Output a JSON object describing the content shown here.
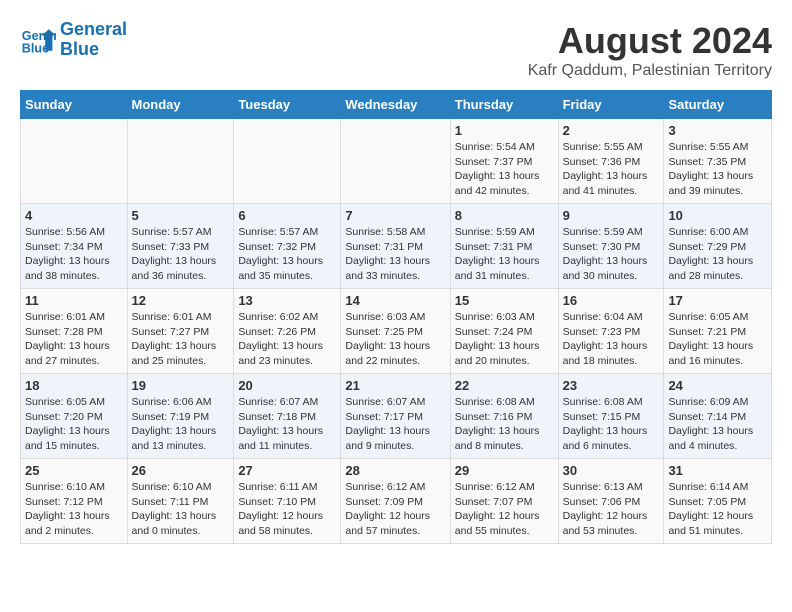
{
  "header": {
    "logo_line1": "General",
    "logo_line2": "Blue",
    "title": "August 2024",
    "subtitle": "Kafr Qaddum, Palestinian Territory"
  },
  "calendar": {
    "days_of_week": [
      "Sunday",
      "Monday",
      "Tuesday",
      "Wednesday",
      "Thursday",
      "Friday",
      "Saturday"
    ],
    "weeks": [
      [
        {
          "day": "",
          "info": ""
        },
        {
          "day": "",
          "info": ""
        },
        {
          "day": "",
          "info": ""
        },
        {
          "day": "",
          "info": ""
        },
        {
          "day": "1",
          "info": "Sunrise: 5:54 AM\nSunset: 7:37 PM\nDaylight: 13 hours\nand 42 minutes."
        },
        {
          "day": "2",
          "info": "Sunrise: 5:55 AM\nSunset: 7:36 PM\nDaylight: 13 hours\nand 41 minutes."
        },
        {
          "day": "3",
          "info": "Sunrise: 5:55 AM\nSunset: 7:35 PM\nDaylight: 13 hours\nand 39 minutes."
        }
      ],
      [
        {
          "day": "4",
          "info": "Sunrise: 5:56 AM\nSunset: 7:34 PM\nDaylight: 13 hours\nand 38 minutes."
        },
        {
          "day": "5",
          "info": "Sunrise: 5:57 AM\nSunset: 7:33 PM\nDaylight: 13 hours\nand 36 minutes."
        },
        {
          "day": "6",
          "info": "Sunrise: 5:57 AM\nSunset: 7:32 PM\nDaylight: 13 hours\nand 35 minutes."
        },
        {
          "day": "7",
          "info": "Sunrise: 5:58 AM\nSunset: 7:31 PM\nDaylight: 13 hours\nand 33 minutes."
        },
        {
          "day": "8",
          "info": "Sunrise: 5:59 AM\nSunset: 7:31 PM\nDaylight: 13 hours\nand 31 minutes."
        },
        {
          "day": "9",
          "info": "Sunrise: 5:59 AM\nSunset: 7:30 PM\nDaylight: 13 hours\nand 30 minutes."
        },
        {
          "day": "10",
          "info": "Sunrise: 6:00 AM\nSunset: 7:29 PM\nDaylight: 13 hours\nand 28 minutes."
        }
      ],
      [
        {
          "day": "11",
          "info": "Sunrise: 6:01 AM\nSunset: 7:28 PM\nDaylight: 13 hours\nand 27 minutes."
        },
        {
          "day": "12",
          "info": "Sunrise: 6:01 AM\nSunset: 7:27 PM\nDaylight: 13 hours\nand 25 minutes."
        },
        {
          "day": "13",
          "info": "Sunrise: 6:02 AM\nSunset: 7:26 PM\nDaylight: 13 hours\nand 23 minutes."
        },
        {
          "day": "14",
          "info": "Sunrise: 6:03 AM\nSunset: 7:25 PM\nDaylight: 13 hours\nand 22 minutes."
        },
        {
          "day": "15",
          "info": "Sunrise: 6:03 AM\nSunset: 7:24 PM\nDaylight: 13 hours\nand 20 minutes."
        },
        {
          "day": "16",
          "info": "Sunrise: 6:04 AM\nSunset: 7:23 PM\nDaylight: 13 hours\nand 18 minutes."
        },
        {
          "day": "17",
          "info": "Sunrise: 6:05 AM\nSunset: 7:21 PM\nDaylight: 13 hours\nand 16 minutes."
        }
      ],
      [
        {
          "day": "18",
          "info": "Sunrise: 6:05 AM\nSunset: 7:20 PM\nDaylight: 13 hours\nand 15 minutes."
        },
        {
          "day": "19",
          "info": "Sunrise: 6:06 AM\nSunset: 7:19 PM\nDaylight: 13 hours\nand 13 minutes."
        },
        {
          "day": "20",
          "info": "Sunrise: 6:07 AM\nSunset: 7:18 PM\nDaylight: 13 hours\nand 11 minutes."
        },
        {
          "day": "21",
          "info": "Sunrise: 6:07 AM\nSunset: 7:17 PM\nDaylight: 13 hours\nand 9 minutes."
        },
        {
          "day": "22",
          "info": "Sunrise: 6:08 AM\nSunset: 7:16 PM\nDaylight: 13 hours\nand 8 minutes."
        },
        {
          "day": "23",
          "info": "Sunrise: 6:08 AM\nSunset: 7:15 PM\nDaylight: 13 hours\nand 6 minutes."
        },
        {
          "day": "24",
          "info": "Sunrise: 6:09 AM\nSunset: 7:14 PM\nDaylight: 13 hours\nand 4 minutes."
        }
      ],
      [
        {
          "day": "25",
          "info": "Sunrise: 6:10 AM\nSunset: 7:12 PM\nDaylight: 13 hours\nand 2 minutes."
        },
        {
          "day": "26",
          "info": "Sunrise: 6:10 AM\nSunset: 7:11 PM\nDaylight: 13 hours\nand 0 minutes."
        },
        {
          "day": "27",
          "info": "Sunrise: 6:11 AM\nSunset: 7:10 PM\nDaylight: 12 hours\nand 58 minutes."
        },
        {
          "day": "28",
          "info": "Sunrise: 6:12 AM\nSunset: 7:09 PM\nDaylight: 12 hours\nand 57 minutes."
        },
        {
          "day": "29",
          "info": "Sunrise: 6:12 AM\nSunset: 7:07 PM\nDaylight: 12 hours\nand 55 minutes."
        },
        {
          "day": "30",
          "info": "Sunrise: 6:13 AM\nSunset: 7:06 PM\nDaylight: 12 hours\nand 53 minutes."
        },
        {
          "day": "31",
          "info": "Sunrise: 6:14 AM\nSunset: 7:05 PM\nDaylight: 12 hours\nand 51 minutes."
        }
      ]
    ]
  }
}
